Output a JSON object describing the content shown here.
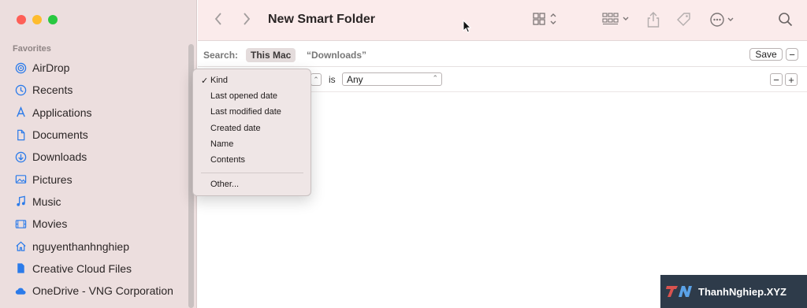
{
  "window": {
    "title": "New Smart Folder"
  },
  "sidebar": {
    "section_title": "Favorites",
    "items": [
      {
        "label": "AirDrop",
        "icon": "airdrop-icon"
      },
      {
        "label": "Recents",
        "icon": "clock-icon"
      },
      {
        "label": "Applications",
        "icon": "applications-icon"
      },
      {
        "label": "Documents",
        "icon": "document-icon"
      },
      {
        "label": "Downloads",
        "icon": "download-icon"
      },
      {
        "label": "Pictures",
        "icon": "pictures-icon"
      },
      {
        "label": "Music",
        "icon": "music-icon"
      },
      {
        "label": "Movies",
        "icon": "movies-icon"
      },
      {
        "label": "nguyenthanhnghiep",
        "icon": "home-icon"
      },
      {
        "label": "Creative Cloud Files",
        "icon": "file-icon"
      },
      {
        "label": "OneDrive - VNG Corporation",
        "icon": "cloud-icon"
      }
    ]
  },
  "search": {
    "label": "Search:",
    "scope_active": "This Mac",
    "scope_other": "“Downloads”",
    "save_label": "Save",
    "minus_label": "−"
  },
  "criteria": {
    "operator": "is",
    "value": "Any",
    "minus_label": "−",
    "plus_label": "+"
  },
  "menu": {
    "checked": "✓",
    "items": [
      "Kind",
      "Last opened date",
      "Last modified date",
      "Created date",
      "Name",
      "Contents"
    ],
    "other": "Other..."
  },
  "watermark": {
    "text": "ThanhNghiep.XYZ"
  },
  "colors": {
    "accent": "#2b7bea",
    "sidebar_bg": "#ecdede",
    "toolbar_bg": "#fbebeb"
  }
}
